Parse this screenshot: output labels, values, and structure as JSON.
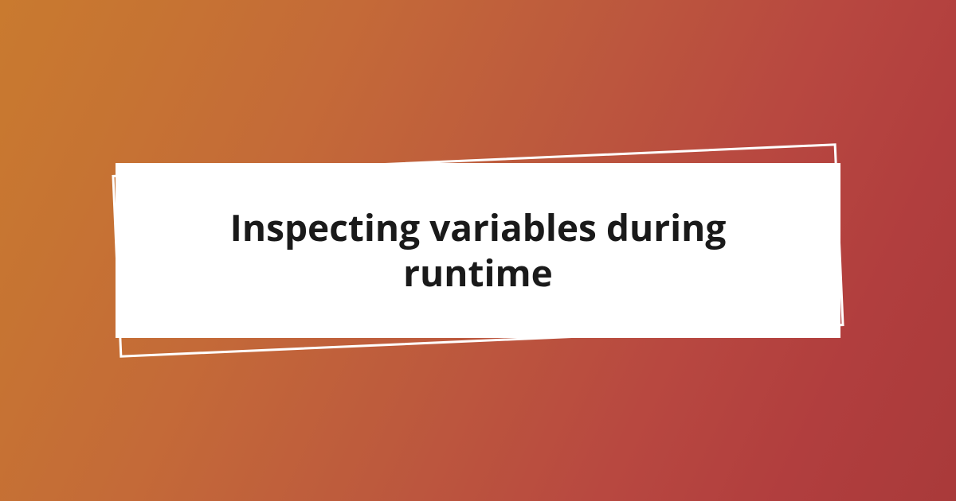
{
  "card": {
    "title": "Inspecting variables during runtime"
  }
}
